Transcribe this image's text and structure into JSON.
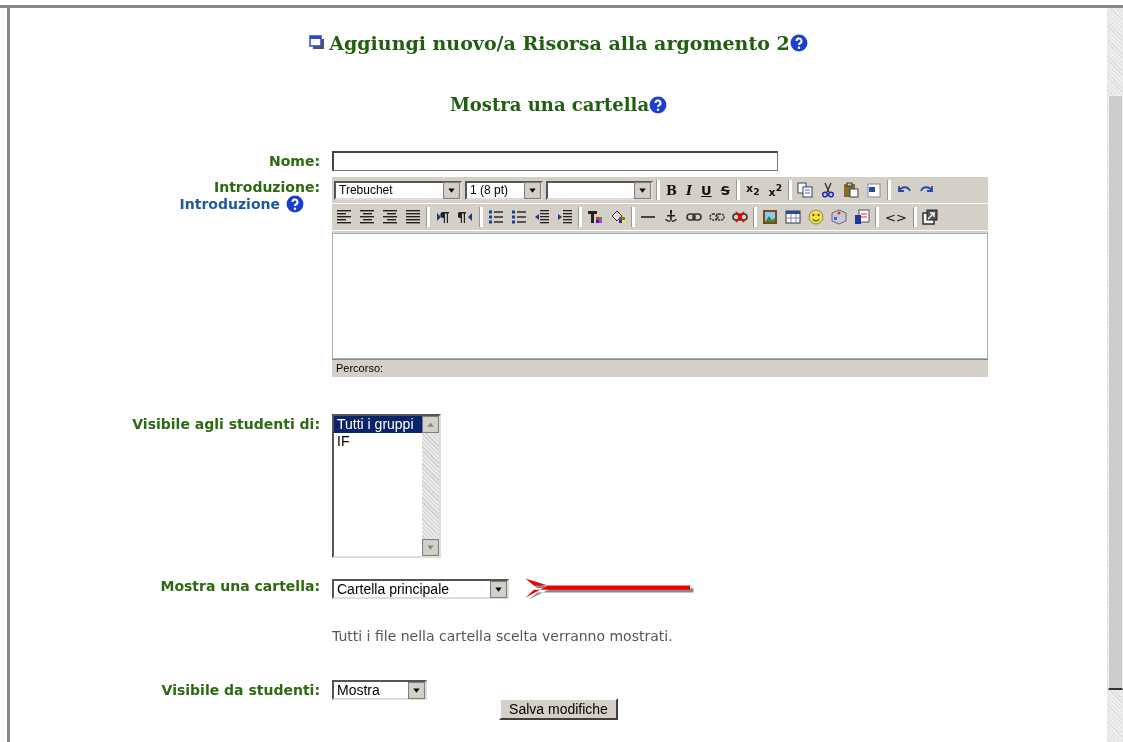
{
  "page_title": "Aggiungi nuovo/a Risorsa alla argomento 2",
  "section_title": "Mostra una cartella",
  "name_field": {
    "label": "Nome:"
  },
  "intro": {
    "label": "Introduzione:",
    "help_link": "Introduzione",
    "font_select": "Trebuchet",
    "size_select": "1 (8 pt)",
    "format_buttons": [
      "B",
      "I",
      "U",
      "S"
    ],
    "script_buttons": [
      "x$_{2}$",
      "x$^{2}$"
    ],
    "source_button": "<>",
    "path_label": "Percorso:"
  },
  "groups": {
    "label": "Visibile agli studenti di:",
    "options": [
      {
        "label": "Tutti i gruppi",
        "selected": true
      },
      {
        "label": "IF",
        "selected": false
      }
    ]
  },
  "folder": {
    "label": "Mostra una cartella:",
    "value": "Cartella principale",
    "hint": "Tutti i file nella cartella scelta verranno mostrati."
  },
  "visibility": {
    "label": "Visibile da studenti:",
    "value": "Mostra"
  },
  "save_button": "Salva modifiche"
}
